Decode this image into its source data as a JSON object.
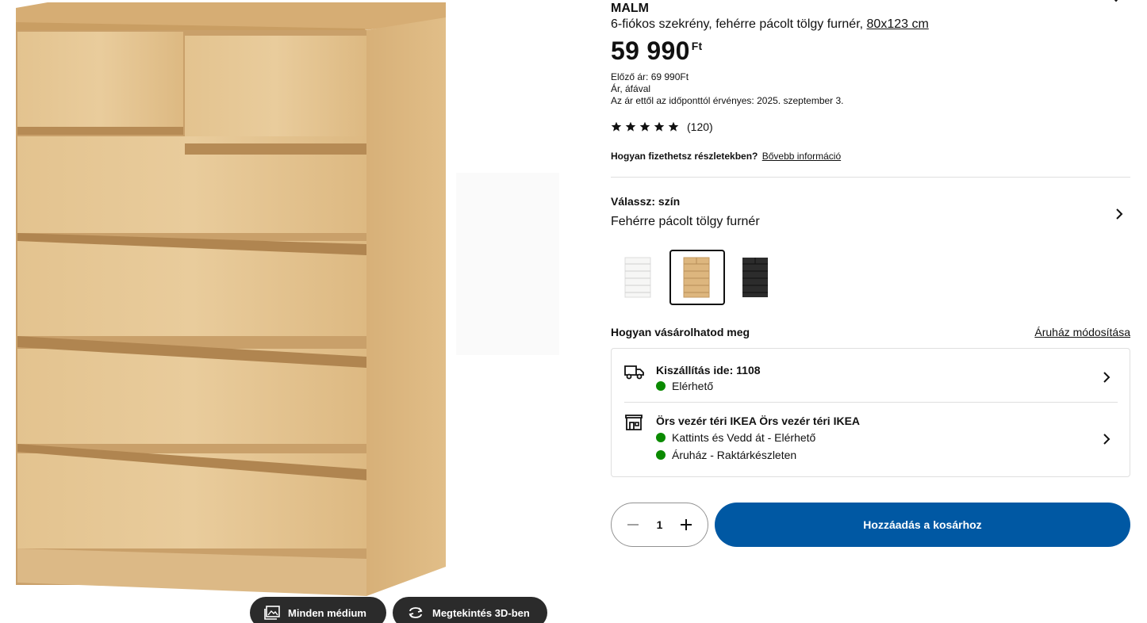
{
  "gallery": {
    "all_media_label": "Minden médium",
    "view_3d_label": "Megtekintés 3D-ben"
  },
  "product": {
    "name": "MALM",
    "description": "6-fiókos szekrény, fehérre pácolt tölgy furnér,",
    "size": "80x123 cm",
    "price": "59 990",
    "currency": "Ft",
    "previous_price": "Előző ár: 69 990Ft",
    "vat_note": "Ár, áfával",
    "valid_from": "Az ár ettől az időponttól érvényes: 2025. szeptember 3.",
    "rating_stars": 5,
    "rating_count": "(120)",
    "installment_question": "Hogyan fizethetsz részletekben?",
    "installment_link": "Bővebb információ"
  },
  "color_choice": {
    "label": "Válassz: szín",
    "selected": "Fehérre pácolt tölgy furnér",
    "swatches": [
      {
        "name": "white",
        "color": "#f4f4f2"
      },
      {
        "name": "white-stained-oak",
        "color": "#ddb67e",
        "selected": true
      },
      {
        "name": "black-brown",
        "color": "#2c2c2c"
      }
    ]
  },
  "purchase": {
    "title": "Hogyan vásárolhatod meg",
    "change_store": "Áruház módosítása",
    "delivery_title": "Kiszállítás ide: 1108",
    "delivery_status": "Elérhető",
    "store_title": "Örs vezér téri IKEA Örs vezér téri IKEA",
    "store_status_1": "Kattints és Vedd át - Elérhető",
    "store_status_2": "Áruház - Raktárkészleten",
    "status_color": "#0a8a00"
  },
  "cart": {
    "quantity": "1",
    "add_label": "Hozzáadás a kosárhoz",
    "button_color": "#0058a3"
  }
}
